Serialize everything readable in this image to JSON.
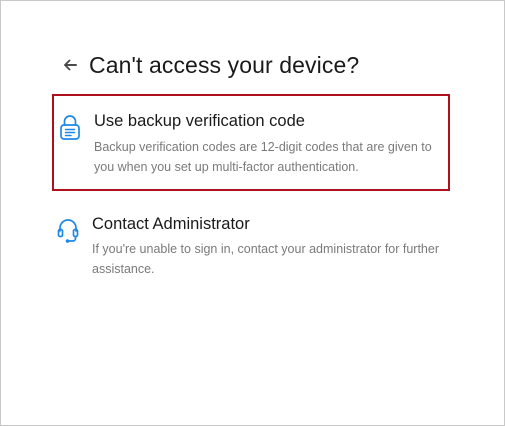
{
  "header": {
    "back_icon": "arrow-left-icon",
    "title": "Can't access your device?"
  },
  "options": [
    {
      "icon": "lock-icon",
      "title": "Use backup verification code",
      "description": "Backup verification codes are 12-digit codes that are given to you when you set up multi-factor authentication.",
      "selected": true
    },
    {
      "icon": "headset-icon",
      "title": "Contact Administrator",
      "description": "If you're unable to sign in, contact your administrator for further assistance.",
      "selected": false
    }
  ],
  "colors": {
    "accent_icon": "#1e88e5",
    "selection_border": "#b00f1c",
    "title_text": "#1a1a1a",
    "muted_text": "#7a7a7a"
  }
}
